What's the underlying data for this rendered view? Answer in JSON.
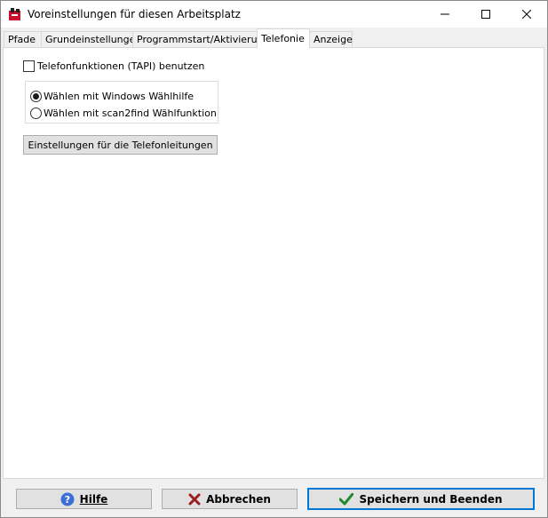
{
  "window": {
    "title": "Voreinstellungen für diesen Arbeitsplatz"
  },
  "tabs": [
    {
      "label": "Pfade",
      "active": false
    },
    {
      "label": "Grundeinstellungen",
      "active": false
    },
    {
      "label": "Programmstart/Aktivierung",
      "active": false
    },
    {
      "label": "Telefonie",
      "active": true
    },
    {
      "label": "Anzeige",
      "active": false
    }
  ],
  "telefonie": {
    "tapi_checkbox_label": "Telefonfunktionen (TAPI) benutzen",
    "tapi_checked": false,
    "dial_options": [
      {
        "label": "Wählen mit Windows Wählhilfe",
        "selected": true
      },
      {
        "label": "Wählen mit scan2find Wählfunktion",
        "selected": false
      }
    ],
    "settings_button_label": "Einstellungen für die Telefonleitungen"
  },
  "footer": {
    "help_label": "Hilfe",
    "cancel_label": "Abbrechen",
    "save_label": "Speichern und Beenden"
  },
  "icons": {
    "app": "app-logo-icon",
    "help": "help-icon",
    "cancel": "cancel-x-icon",
    "save": "checkmark-icon"
  },
  "colors": {
    "help_icon": "#3b6fd6",
    "cancel_icon": "#9b1c1c",
    "save_icon": "#1f8a2e",
    "default_button_border": "#0078d7"
  }
}
